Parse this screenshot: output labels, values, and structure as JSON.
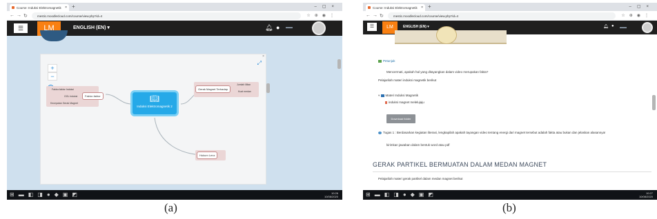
{
  "captions": {
    "a": "(a)",
    "b": "(b)"
  },
  "panel_a": {
    "tab_title": "Course: Induksi Elektromagnetik",
    "url": "mestic.moodlecloud.com/course/view.php?id=4",
    "logo": "LM",
    "language": "ENGLISH (EN) ▾",
    "mindmap": {
      "center": "Induksi Elektromagnetik 2",
      "left_node": "Faktor-faktor",
      "left_small_1": "Faktor-faktor Induksi",
      "left_small_2": "GGL Induksi",
      "left_small_3": "Kecepatan Gerak Magnet",
      "right_node": "Gerak Magnet Terhadap",
      "right_small_1": "Jumlah lilitan",
      "right_small_2": "Kuat medan",
      "bottom_node": "Hukum Lenz"
    },
    "tray_time": "10:26",
    "tray_date": "10/08/2020"
  },
  "panel_b": {
    "tab_title": "Course: Induksi Elektromagnetik",
    "url": "mestic.moodlecloud.com/course/view.php?id=4",
    "logo": "LM",
    "language": "ENGLISH (EN) ▾",
    "items": {
      "petunjuk": "Petunjuk",
      "q1": "Mencermati, apakah hal yang ditayangkan dalam video merupakan fakta?",
      "note1": "Pelajarilah materi induksi magnetik berikut",
      "folder": "Materi Induksi Magnetik",
      "file": "induksi magnet melelujaju",
      "button": "Download folder",
      "task": "Tugas 1 : Berdasarkan kegiatan literasi, lengkapilah apakah tayangan video tentang energi dari magnet tersebut adalah fakta atau bukan dan jelaskan alasannya!",
      "task_note": "kirimkan jawaban dalam bentuk word atau pdf"
    },
    "section_title": "GERAK PARTIKEL BERMUATAN DALAM MEDAN MAGNET",
    "section_note": "Pelajarilah materi gerak partikel dalam medan magnet berikut",
    "tray_time": "10:27",
    "tray_date": "10/08/2020"
  }
}
